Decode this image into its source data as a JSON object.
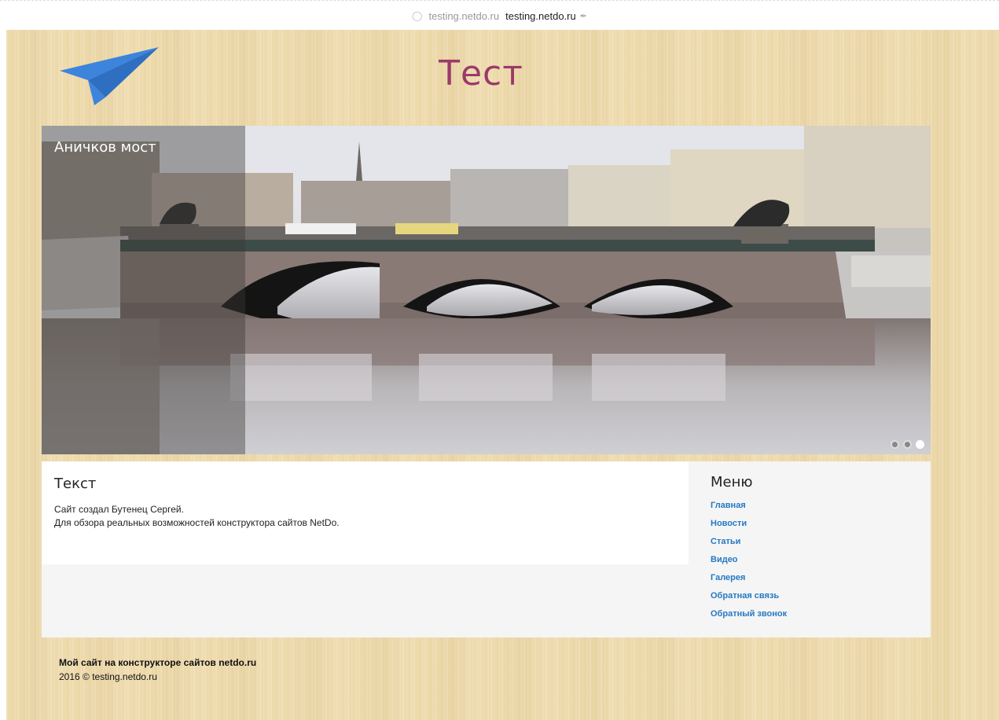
{
  "topbar": {
    "domain_gray": "testing.netdo.ru",
    "domain_dark": "testing.netdo.ru"
  },
  "header": {
    "title": "Тест",
    "title_color": "#9a3a6a",
    "logo": "paper-plane-icon"
  },
  "slider": {
    "caption": "Аничков мост",
    "slides_total": 3,
    "active_slide": 3
  },
  "content": {
    "heading": "Текст",
    "line1": "Сайт создал Бутенец Сергей.",
    "line2": "Для обзора реальных возможностей конструктора сайтов NetDo."
  },
  "menu": {
    "heading": "Меню",
    "items": [
      "Главная",
      "Новости",
      "Статьи",
      "Видео",
      "Галерея",
      "Обратная связь",
      "Обратный звонок"
    ],
    "link_color": "#2479c2"
  },
  "footer": {
    "line1": "Мой сайт на конструкторе сайтов netdo.ru",
    "line2": "2016 © testing.netdo.ru"
  }
}
